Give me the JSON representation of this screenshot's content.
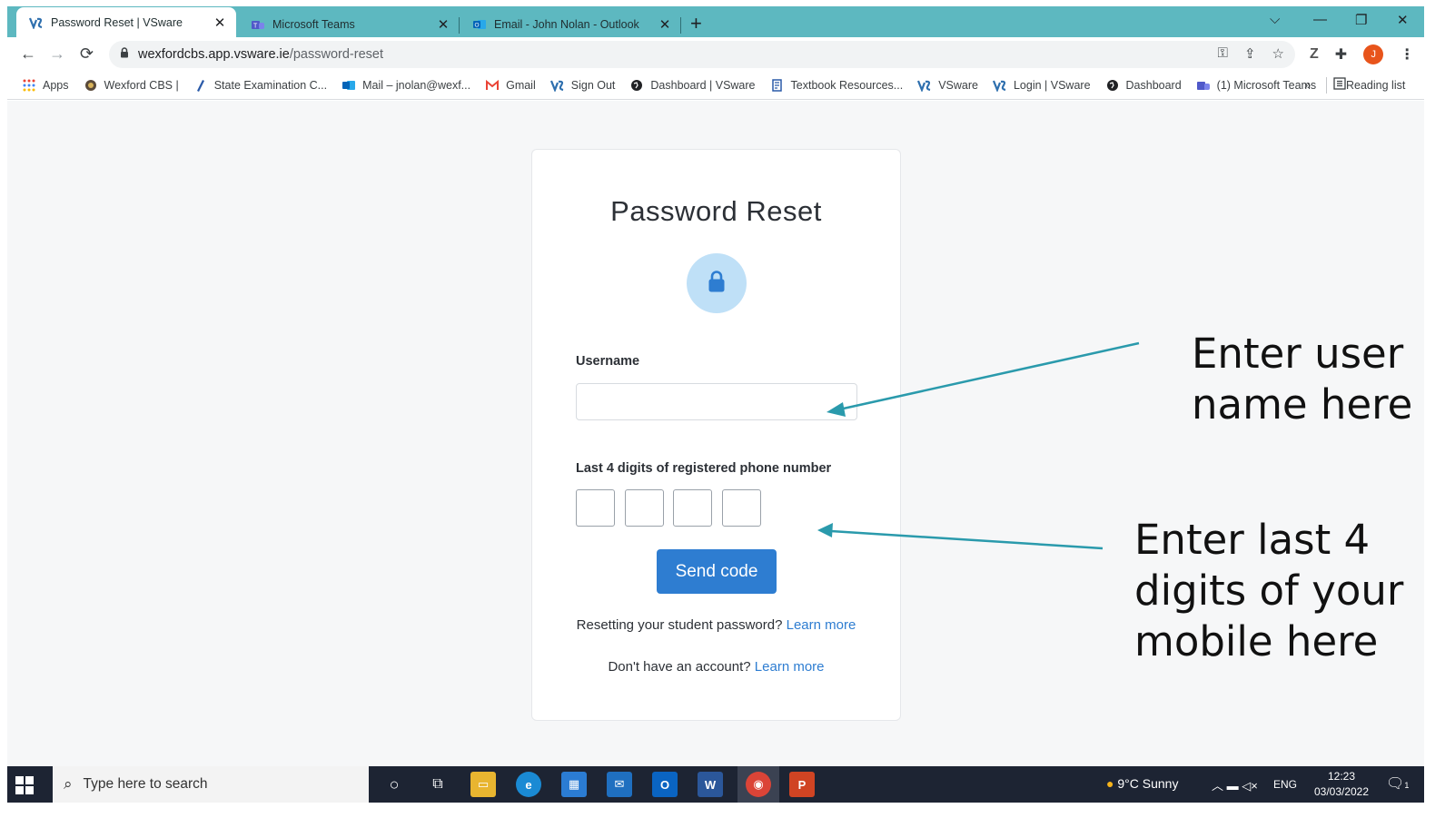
{
  "browser": {
    "tabs": [
      {
        "title": "Password Reset | VSware",
        "active": true
      },
      {
        "title": "Microsoft Teams",
        "active": false
      },
      {
        "title": "Email - John Nolan - Outlook",
        "active": false
      }
    ],
    "url_host": "wexfordcbs.app.vsware.ie",
    "url_path": "/password-reset",
    "profile_initial": "J",
    "bookmarks": [
      {
        "label": "Apps",
        "icon": "apps-grid-icon"
      },
      {
        "label": "Wexford CBS |",
        "icon": "school-crest-icon"
      },
      {
        "label": "State Examination C...",
        "icon": "exam-icon"
      },
      {
        "label": "Mail – jnolan@wexf...",
        "icon": "outlook-icon"
      },
      {
        "label": "Gmail",
        "icon": "gmail-icon"
      },
      {
        "label": "Sign Out",
        "icon": "vsware-icon"
      },
      {
        "label": "Dashboard | VSware",
        "icon": "globe-icon"
      },
      {
        "label": "Textbook Resources...",
        "icon": "textbook-icon"
      },
      {
        "label": "VSware",
        "icon": "vsware-icon"
      },
      {
        "label": "Login | VSware",
        "icon": "vsware-icon"
      },
      {
        "label": "Dashboard",
        "icon": "globe-icon"
      },
      {
        "label": "(1) Microsoft Teams",
        "icon": "teams-icon"
      }
    ],
    "more_bookmarks": "»",
    "reading_list": "Reading list"
  },
  "page": {
    "title": "Password Reset",
    "username_label": "Username",
    "username_value": "",
    "phone_label": "Last 4 digits of registered phone number",
    "digits": [
      "",
      "",
      "",
      ""
    ],
    "send_button": "Send code",
    "student_prompt": "Resetting your student password?",
    "student_link": "Learn more",
    "account_prompt": "Don't have an account?",
    "account_link": "Learn more"
  },
  "annotations": {
    "username_note": [
      "Enter user",
      "name here"
    ],
    "digits_note": [
      "Enter last 4",
      "digits of your",
      "mobile here"
    ]
  },
  "taskbar": {
    "search_placeholder": "Type here to search",
    "weather": "9°C  Sunny",
    "language": "ENG",
    "time": "12:23",
    "date": "03/03/2022",
    "notification_count": "1"
  },
  "colors": {
    "tabbar": "#5db8c0",
    "accent": "#2e7dd1",
    "annotation_arrow": "#2a9aac",
    "taskbar": "#1d2433"
  }
}
